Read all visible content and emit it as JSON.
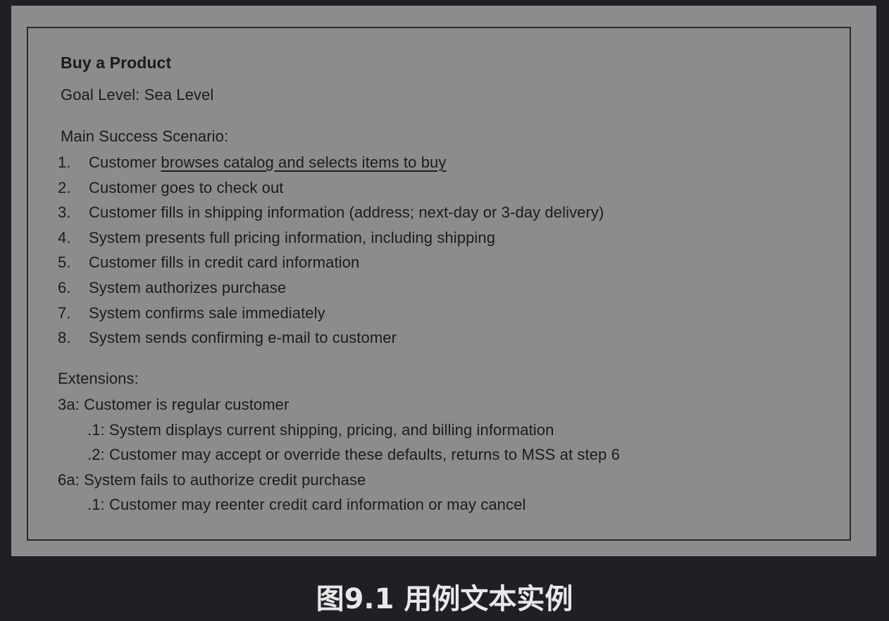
{
  "document": {
    "title": "Buy a Product",
    "goal_level": "Goal Level: Sea Level",
    "main_success_heading": "Main Success Scenario:",
    "steps": [
      {
        "num": "1.",
        "text": "Customer ",
        "underlined": "browses catalog and selects items to buy"
      },
      {
        "num": "2.",
        "text": "Customer goes to check out"
      },
      {
        "num": "3.",
        "text": "Customer fills in shipping information (address; next-day or 3-day delivery)"
      },
      {
        "num": "4.",
        "text": "System presents full pricing information, including shipping"
      },
      {
        "num": "5.",
        "text": "Customer fills in credit card information"
      },
      {
        "num": "6.",
        "text": "System authorizes purchase"
      },
      {
        "num": "7.",
        "text": "System confirms sale immediately"
      },
      {
        "num": "8.",
        "text": "System sends confirming e-mail to customer"
      }
    ],
    "extensions_heading": "Extensions:",
    "extensions": [
      {
        "text": "3a: Customer is regular customer",
        "sub": false
      },
      {
        "text": ".1: System displays current shipping, pricing, and billing information",
        "sub": true
      },
      {
        "text": ".2: Customer may accept or override these defaults, returns to MSS at step 6",
        "sub": true
      },
      {
        "text": "6a: System fails to authorize credit purchase",
        "sub": false
      },
      {
        "text": ".1: Customer may reenter credit card information or may cancel",
        "sub": true
      }
    ]
  },
  "caption": "图9.1 用例文本实例"
}
